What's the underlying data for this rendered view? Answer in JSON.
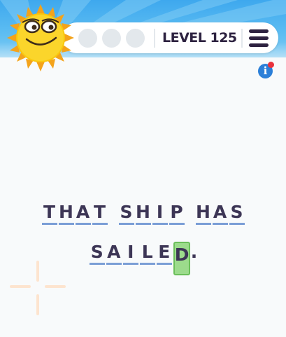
{
  "header": {
    "level_label": "LEVEL 125",
    "hint_slots": 3,
    "menu_icon": "hamburger-menu-icon",
    "character_icon": "smiling-sun-icon"
  },
  "info_icon": {
    "glyph": "i",
    "has_notification": true
  },
  "phrase": {
    "lines": [
      {
        "words": [
          [
            "T",
            "H",
            "A",
            "T"
          ],
          [
            "S",
            "H",
            "I",
            "P"
          ],
          [
            "H",
            "A",
            "S"
          ]
        ]
      },
      {
        "words": [
          [
            "S",
            "A",
            "I",
            "L",
            "E",
            "D"
          ]
        ],
        "suffix": "."
      }
    ],
    "selected_letter": "D"
  },
  "colors": {
    "sky": "#5bbcf2",
    "text": "#2d2240",
    "underline": "#7b9ed6",
    "selection": "#9cdb8c",
    "sun": "#f9c80e"
  }
}
